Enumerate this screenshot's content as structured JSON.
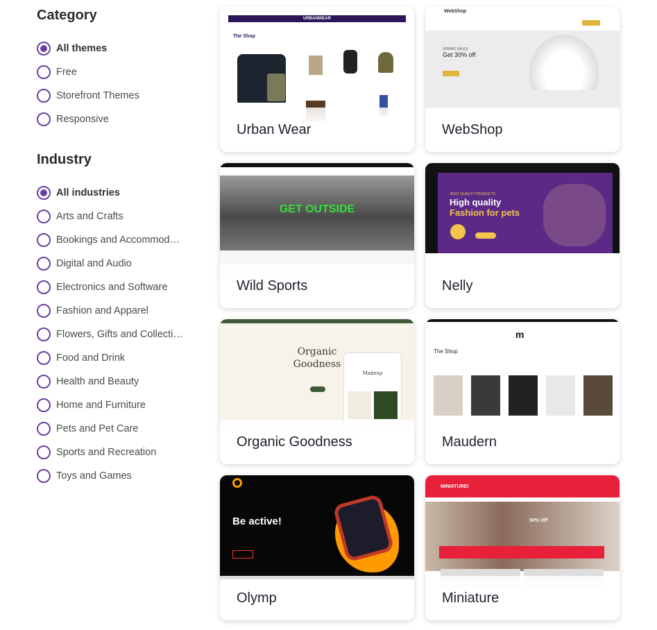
{
  "sidebar": {
    "category": {
      "heading": "Category",
      "options": [
        "All themes",
        "Free",
        "Storefront Themes",
        "Responsive"
      ],
      "selected": "All themes"
    },
    "industry": {
      "heading": "Industry",
      "options": [
        "All industries",
        "Arts and Crafts",
        "Bookings and Accommoda…",
        "Digital and Audio",
        "Electronics and Software",
        "Fashion and Apparel",
        "Flowers, Gifts and Collecti…",
        "Food and Drink",
        "Health and Beauty",
        "Home and Furniture",
        "Pets and Pet Care",
        "Sports and Recreation",
        "Toys and Games"
      ],
      "selected": "All industries"
    }
  },
  "themes": [
    {
      "title": "Urban Wear",
      "preview": {
        "brand": "URBANWEAR",
        "heading": "The Shop"
      },
      "accent": "#2b1659"
    },
    {
      "title": "WebShop",
      "preview": {
        "brand": "WebShop",
        "heading": "Get 30% off",
        "kicker": "SPRING SALES"
      },
      "accent": "#e0b43a"
    },
    {
      "title": "Wild Sports",
      "preview": {
        "heading": "GET OUTSIDE"
      },
      "accent": "#33e03a"
    },
    {
      "title": "Nelly",
      "preview": {
        "heading1": "High quality",
        "heading2": "Fashion for pets",
        "kicker": "BEST QUALITY PRODUCTS"
      },
      "accent": "#5b2a86"
    },
    {
      "title": "Organic Goodness",
      "preview": {
        "heading": "Organic Goodness",
        "sub": "Makeup"
      },
      "accent": "#3e5a36"
    },
    {
      "title": "Maudern",
      "preview": {
        "brand": "m",
        "heading": "The Shop"
      },
      "accent": "#111111"
    },
    {
      "title": "Olymp",
      "preview": {
        "heading": "Be active!"
      },
      "accent": "#ff9a00"
    },
    {
      "title": "Miniature",
      "preview": {
        "brand": "MINIATURE!",
        "badge": "50% Off"
      },
      "accent": "#e8203a"
    }
  ]
}
